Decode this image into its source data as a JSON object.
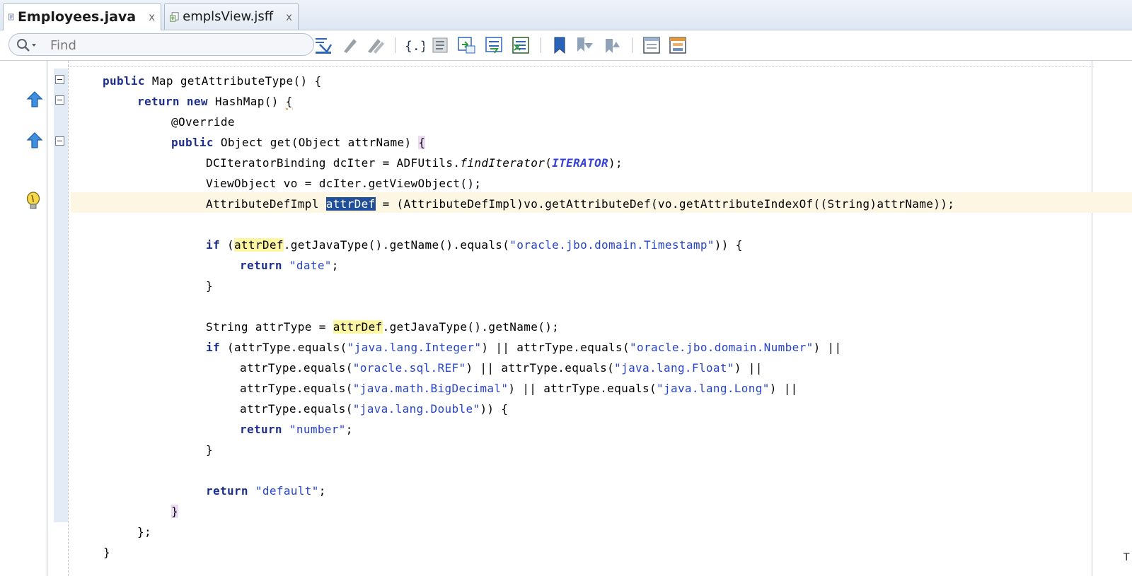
{
  "tabs": [
    {
      "label": "Employees.java",
      "active": true,
      "icon": "java-file-icon",
      "close": "x"
    },
    {
      "label": "emplsView.jsff",
      "active": false,
      "icon": "jsff-file-icon",
      "close": "x"
    }
  ],
  "toolbar": {
    "search_placeholder": "Find",
    "buttons": [
      "navigate-icon",
      "format-icon",
      "reformat-icon",
      "braces-icon",
      "toggle-comment-icon",
      "surround-icon",
      "indent-icon",
      "unindent-icon",
      "bookmark-icon",
      "next-bookmark-icon",
      "prev-bookmark-icon",
      "panel-layout-icon",
      "split-layout-icon"
    ]
  },
  "editor": {
    "lines": [
      {
        "segments": [
          {
            "t": "public",
            "c": "kw"
          },
          {
            "t": " Map getAttributeType() {"
          }
        ]
      },
      {
        "segments": [
          {
            "t": "return",
            "c": "kw"
          },
          {
            "t": " "
          },
          {
            "t": "new",
            "c": "kw"
          },
          {
            "t": " HashMap() "
          },
          {
            "t": "{",
            "c": "squiggle"
          }
        ]
      },
      {
        "segments": [
          {
            "t": "@Override"
          }
        ]
      },
      {
        "segments": [
          {
            "t": "public",
            "c": "kw"
          },
          {
            "t": " Object get(Object attrName) "
          },
          {
            "t": "{",
            "c": "brace"
          }
        ]
      },
      {
        "segments": [
          {
            "t": "DCIteratorBinding dcIter = ADFUtils."
          },
          {
            "t": "findIterator",
            "c": "it"
          },
          {
            "t": "("
          },
          {
            "t": "ITERATOR",
            "c": "const"
          },
          {
            "t": ");"
          }
        ]
      },
      {
        "segments": [
          {
            "t": "ViewObject vo = dcIter.getViewObject();"
          }
        ]
      },
      {
        "segments": [
          {
            "t": "AttributeDefImpl "
          },
          {
            "t": "attrDef",
            "c": "sel"
          },
          {
            "t": " = (AttributeDefImpl)vo.getAttributeDef(vo.getAttributeIndexOf((String)attrName));"
          }
        ]
      },
      {
        "segments": []
      },
      {
        "segments": [
          {
            "t": "if",
            "c": "kw"
          },
          {
            "t": " ("
          },
          {
            "t": "attrDef",
            "c": "occ"
          },
          {
            "t": ".getJavaType().getName().equals("
          },
          {
            "t": "\"oracle.jbo.domain.Timestamp\"",
            "c": "str"
          },
          {
            "t": ")) {"
          }
        ]
      },
      {
        "segments": [
          {
            "t": "return",
            "c": "kw"
          },
          {
            "t": " "
          },
          {
            "t": "\"date\"",
            "c": "str"
          },
          {
            "t": ";"
          }
        ]
      },
      {
        "segments": [
          {
            "t": "}"
          }
        ]
      },
      {
        "segments": []
      },
      {
        "segments": [
          {
            "t": "String attrType = "
          },
          {
            "t": "attrDef",
            "c": "occ"
          },
          {
            "t": ".getJavaType().getName();"
          }
        ]
      },
      {
        "segments": [
          {
            "t": "if",
            "c": "kw"
          },
          {
            "t": " (attrType.equals("
          },
          {
            "t": "\"java.lang.Integer\"",
            "c": "str"
          },
          {
            "t": ") || attrType.equals("
          },
          {
            "t": "\"oracle.jbo.domain.Number\"",
            "c": "str"
          },
          {
            "t": ") ||"
          }
        ]
      },
      {
        "segments": [
          {
            "t": "attrType.equals("
          },
          {
            "t": "\"oracle.sql.REF\"",
            "c": "str"
          },
          {
            "t": ") || attrType.equals("
          },
          {
            "t": "\"java.lang.Float\"",
            "c": "str"
          },
          {
            "t": ") ||"
          }
        ]
      },
      {
        "segments": [
          {
            "t": "attrType.equals("
          },
          {
            "t": "\"java.math.BigDecimal\"",
            "c": "str"
          },
          {
            "t": ") || attrType.equals("
          },
          {
            "t": "\"java.lang.Long\"",
            "c": "str"
          },
          {
            "t": ") ||"
          }
        ]
      },
      {
        "segments": [
          {
            "t": "attrType.equals("
          },
          {
            "t": "\"java.lang.Double\"",
            "c": "str"
          },
          {
            "t": ")) {"
          }
        ]
      },
      {
        "segments": [
          {
            "t": "return",
            "c": "kw"
          },
          {
            "t": " "
          },
          {
            "t": "\"number\"",
            "c": "str"
          },
          {
            "t": ";"
          }
        ]
      },
      {
        "segments": [
          {
            "t": "}"
          }
        ]
      },
      {
        "segments": []
      },
      {
        "segments": [
          {
            "t": "return",
            "c": "kw"
          },
          {
            "t": " "
          },
          {
            "t": "\"default\"",
            "c": "str"
          },
          {
            "t": ";"
          }
        ]
      },
      {
        "segments": [
          {
            "t": "}",
            "c": "brace"
          }
        ]
      },
      {
        "segments": [
          {
            "t": "};"
          }
        ]
      },
      {
        "segments": [
          {
            "t": "}"
          }
        ]
      }
    ],
    "right_edge_text": "T"
  }
}
